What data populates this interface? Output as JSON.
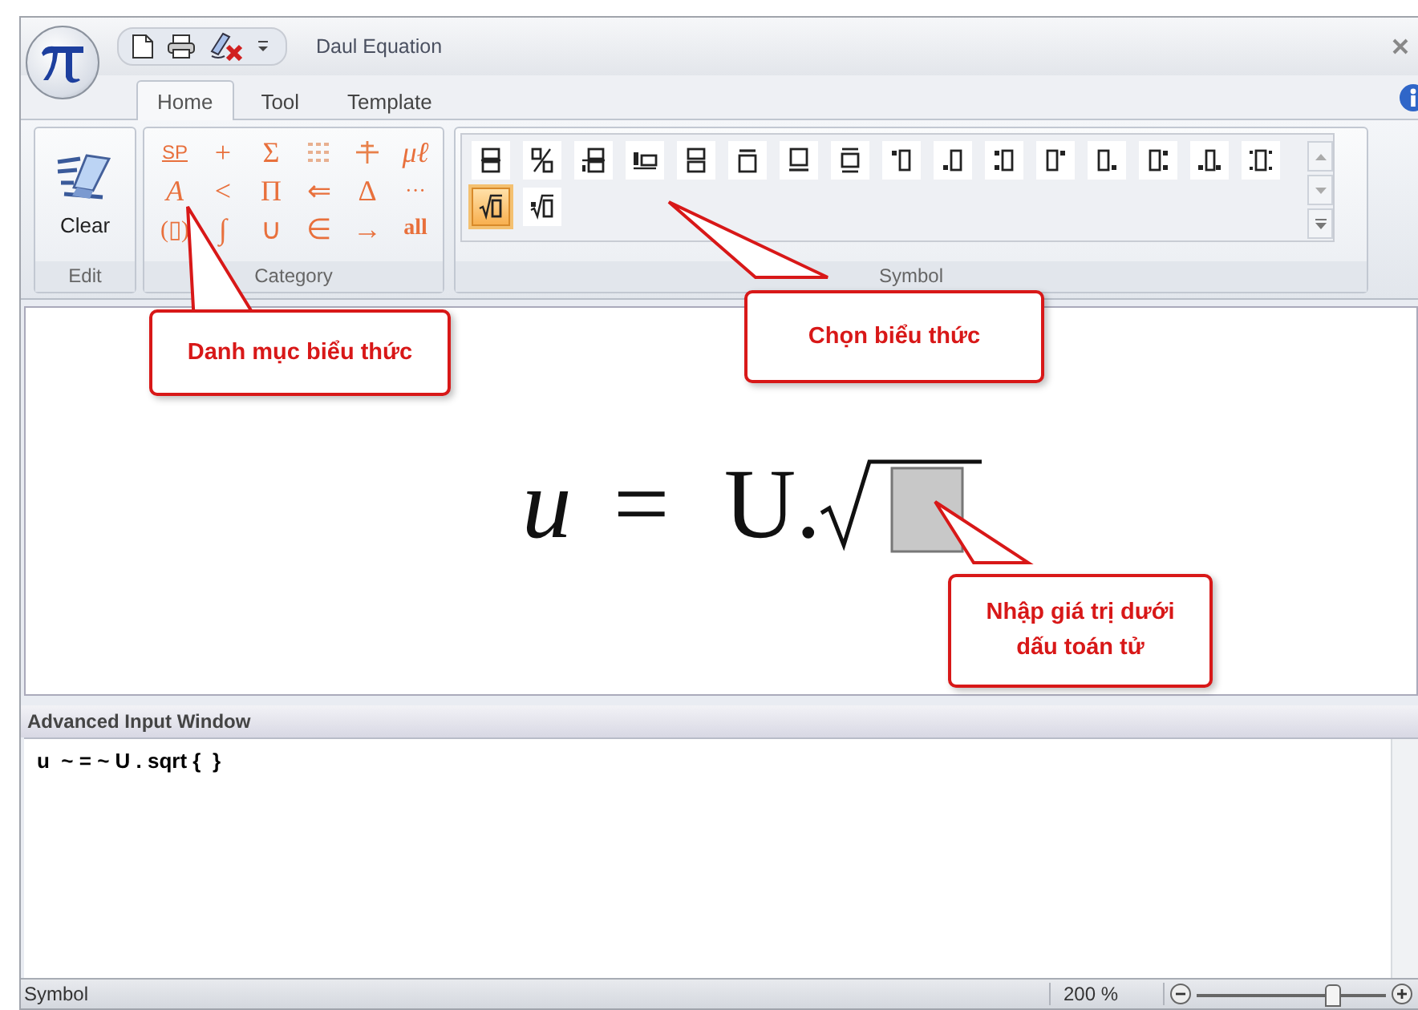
{
  "window": {
    "title": "Daul Equation"
  },
  "tabs": [
    {
      "label": "Home",
      "selected": true
    },
    {
      "label": "Tool",
      "selected": false
    },
    {
      "label": "Template",
      "selected": false
    }
  ],
  "ribbon": {
    "edit": {
      "button": "Clear",
      "group_label": "Edit"
    },
    "category": {
      "group_label": "Category",
      "items": [
        {
          "kind": "text",
          "label": "SP"
        },
        {
          "kind": "text",
          "label": "+"
        },
        {
          "kind": "text",
          "label": "Σ"
        },
        {
          "kind": "icon"
        },
        {
          "kind": "icon"
        },
        {
          "kind": "text",
          "label": "μℓ"
        },
        {
          "kind": "text",
          "label": "A"
        },
        {
          "kind": "text",
          "label": "<"
        },
        {
          "kind": "text",
          "label": "Π"
        },
        {
          "kind": "text",
          "label": "⇐"
        },
        {
          "kind": "text",
          "label": "Δ"
        },
        {
          "kind": "text",
          "label": "···"
        },
        {
          "kind": "text",
          "label": "(▯)"
        },
        {
          "kind": "text",
          "label": "∫"
        },
        {
          "kind": "text",
          "label": "∪"
        },
        {
          "kind": "text",
          "label": "∈"
        },
        {
          "kind": "text",
          "label": "→"
        },
        {
          "kind": "text",
          "label": "all"
        }
      ]
    },
    "symbol": {
      "group_label": "Symbol",
      "items": [
        {
          "selected": false
        },
        {
          "selected": false
        },
        {
          "selected": false
        },
        {
          "selected": false
        },
        {
          "selected": false
        },
        {
          "selected": false
        },
        {
          "selected": false
        },
        {
          "selected": false
        },
        {
          "selected": false
        },
        {
          "selected": false
        },
        {
          "selected": false
        },
        {
          "selected": false
        },
        {
          "selected": false
        },
        {
          "selected": false
        },
        {
          "selected": false
        },
        {
          "selected": false
        },
        {
          "selected": true
        },
        {
          "selected": false
        }
      ]
    }
  },
  "equation": {
    "lhs": "u",
    "operator": "=",
    "rhs": "U."
  },
  "callouts": [
    {
      "text": "Danh mục biểu thức"
    },
    {
      "text": "Chọn biểu thức"
    },
    {
      "text": "Nhập giá trị dưới dấu toán tử"
    }
  ],
  "advanced_input": {
    "title": "Advanced Input Window",
    "value": "u  ~ = ~ U . sqrt {  }"
  },
  "status_bar": {
    "mode": "Symbol",
    "zoom": "200 %",
    "zoom_slider": {
      "level": 0.72
    }
  }
}
